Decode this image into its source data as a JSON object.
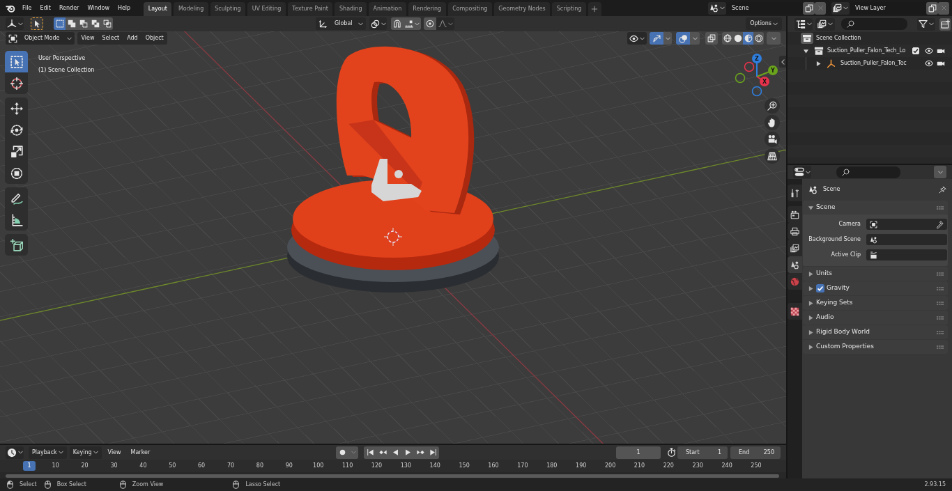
{
  "top_bar": {
    "menus": [
      "File",
      "Edit",
      "Render",
      "Window",
      "Help"
    ],
    "workspaces": [
      {
        "label": "Layout",
        "selected": true
      },
      {
        "label": "Modeling",
        "selected": false
      },
      {
        "label": "Sculpting",
        "selected": false
      },
      {
        "label": "UV Editing",
        "selected": false
      },
      {
        "label": "Texture Paint",
        "selected": false
      },
      {
        "label": "Shading",
        "selected": false
      },
      {
        "label": "Animation",
        "selected": false
      },
      {
        "label": "Rendering",
        "selected": false
      },
      {
        "label": "Compositing",
        "selected": false
      },
      {
        "label": "Geometry Nodes",
        "selected": false
      },
      {
        "label": "Scripting",
        "selected": false
      }
    ],
    "scene": "Scene",
    "view_layer": "View Layer"
  },
  "viewport": {
    "header": {
      "select_modes": [
        {
          "selected": true
        },
        {
          "selected": false
        },
        {
          "selected": false
        },
        {
          "selected": false
        },
        {
          "selected": false
        }
      ],
      "transform_orientation": "Global",
      "snap": {
        "on": false
      },
      "proportional_editing": {
        "on": false
      },
      "options": "Options",
      "mode": "Object Mode",
      "menus": [
        "View",
        "Select",
        "Add",
        "Object"
      ],
      "gizmos": {
        "on": true
      },
      "overlays": {
        "on": true
      },
      "xray": {
        "on": false
      },
      "shading_modes": [
        {
          "selected": false
        },
        {
          "selected": false
        },
        {
          "selected": true
        },
        {
          "selected": false
        }
      ]
    },
    "tools": [
      {
        "selected": true
      },
      {
        "selected": false
      },
      {
        "selected": false
      },
      {
        "selected": false
      },
      {
        "selected": false
      },
      {
        "selected": false
      },
      {
        "selected": false
      },
      {
        "selected": false
      },
      {
        "selected": false
      }
    ],
    "info": [
      "User Perspective",
      "(1) Scene Collection"
    ],
    "navigation_gizmo": {
      "axes": [
        {
          "label": "Z",
          "color": "#2f7fe0"
        },
        {
          "label": "Y",
          "color": "#6aa31c"
        },
        {
          "label": "X",
          "color": "#e8324c"
        }
      ]
    }
  },
  "outliner": {
    "items": [
      {
        "label": "Scene Collection",
        "kind": "root",
        "children": [
          {
            "label": "Suction_Puller_Falon_Tech_Lo",
            "kind": "collection",
            "expanded": true,
            "checked": true,
            "children": [
              {
                "label": "Suction_Puller_Falon_Tec",
                "kind": "object",
                "expanded": false
              }
            ]
          }
        ]
      }
    ]
  },
  "properties": {
    "tabs": [
      {
        "selected": false
      },
      {
        "selected": false
      },
      {
        "selected": false
      },
      {
        "selected": false
      },
      {
        "selected": true
      },
      {
        "selected": false
      },
      {
        "selected": false
      }
    ],
    "context": "Scene",
    "panels": [
      {
        "title": "Scene",
        "expanded": true,
        "fields": [
          {
            "label": "Camera"
          },
          {
            "label": "Background Scene"
          },
          {
            "label": "Active Clip"
          }
        ]
      },
      {
        "title": "Units",
        "expanded": false
      },
      {
        "title": "Gravity",
        "expanded": false,
        "checked": true
      },
      {
        "title": "Keying Sets",
        "expanded": false
      },
      {
        "title": "Audio",
        "expanded": false
      },
      {
        "title": "Rigid Body World",
        "expanded": false
      },
      {
        "title": "Custom Properties",
        "expanded": false
      }
    ]
  },
  "timeline": {
    "menus": [
      {
        "label": "Playback",
        "kind": "dropdown"
      },
      {
        "label": "Keying",
        "kind": "dropdown"
      },
      {
        "label": "View",
        "kind": "menu"
      },
      {
        "label": "Marker",
        "kind": "menu"
      }
    ],
    "auto_keying": {
      "on": false
    },
    "current_frame": "1",
    "start": {
      "label": "Start",
      "value": "1"
    },
    "end": {
      "label": "End",
      "value": "250"
    },
    "ruler": [
      {
        "label": "1",
        "selected": true
      },
      {
        "label": "10",
        "selected": false
      },
      {
        "label": "20",
        "selected": false
      },
      {
        "label": "30",
        "selected": false
      },
      {
        "label": "40",
        "selected": false
      },
      {
        "label": "50",
        "selected": false
      },
      {
        "label": "60",
        "selected": false
      },
      {
        "label": "70",
        "selected": false
      },
      {
        "label": "80",
        "selected": false
      },
      {
        "label": "90",
        "selected": false
      },
      {
        "label": "100",
        "selected": false
      },
      {
        "label": "110",
        "selected": false
      },
      {
        "label": "120",
        "selected": false
      },
      {
        "label": "130",
        "selected": false
      },
      {
        "label": "140",
        "selected": false
      },
      {
        "label": "150",
        "selected": false
      },
      {
        "label": "160",
        "selected": false
      },
      {
        "label": "170",
        "selected": false
      },
      {
        "label": "180",
        "selected": false
      },
      {
        "label": "190",
        "selected": false
      },
      {
        "label": "200",
        "selected": false
      },
      {
        "label": "210",
        "selected": false
      },
      {
        "label": "220",
        "selected": false
      },
      {
        "label": "230",
        "selected": false
      },
      {
        "label": "240",
        "selected": false
      },
      {
        "label": "250",
        "selected": false
      }
    ]
  },
  "status_bar": {
    "hints": [
      "Select",
      "Box Select",
      "Zoom View",
      "Lasso Select"
    ],
    "version": "2.93.15"
  }
}
